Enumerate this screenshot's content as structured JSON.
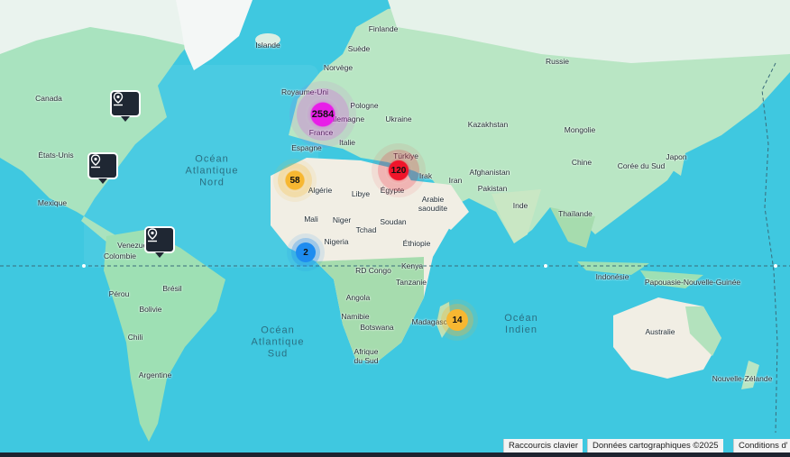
{
  "map": {
    "oceans": [
      {
        "id": "atlantic-north",
        "text": "Océan\nAtlantique\nNord"
      },
      {
        "id": "atlantic-south",
        "text": "Océan\nAtlantique\nSud"
      },
      {
        "id": "indian",
        "text": "Océan\nIndien"
      }
    ],
    "labels": [
      {
        "id": "finlande",
        "text": "Finlande"
      },
      {
        "id": "islande",
        "text": "Islande"
      },
      {
        "id": "suede",
        "text": "Suède"
      },
      {
        "id": "russie",
        "text": "Russie"
      },
      {
        "id": "norvege",
        "text": "Norvège"
      },
      {
        "id": "canada",
        "text": "Canada"
      },
      {
        "id": "royaume-uni",
        "text": "Royaume-Uni"
      },
      {
        "id": "pologne",
        "text": "Pologne"
      },
      {
        "id": "ukraine",
        "text": "Ukraine"
      },
      {
        "id": "kazakhstan",
        "text": "Kazakhstan"
      },
      {
        "id": "allemagne",
        "text": "Allemagne"
      },
      {
        "id": "france",
        "text": "France"
      },
      {
        "id": "mongolie",
        "text": "Mongolie"
      },
      {
        "id": "espagne",
        "text": "Espagne"
      },
      {
        "id": "italie",
        "text": "Italie"
      },
      {
        "id": "turkiye",
        "text": "Türkiye"
      },
      {
        "id": "etats-unis",
        "text": "États-Unis"
      },
      {
        "id": "chine",
        "text": "Chine"
      },
      {
        "id": "japon",
        "text": "Japon"
      },
      {
        "id": "coree-du-sud",
        "text": "Corée du Sud"
      },
      {
        "id": "irak",
        "text": "Irak"
      },
      {
        "id": "afghanistan",
        "text": "Afghanistan"
      },
      {
        "id": "iran",
        "text": "Iran"
      },
      {
        "id": "algerie",
        "text": "Algérie"
      },
      {
        "id": "libye",
        "text": "Libye"
      },
      {
        "id": "egypte",
        "text": "Égypte"
      },
      {
        "id": "pakistan",
        "text": "Pakistan"
      },
      {
        "id": "mexique",
        "text": "Mexique"
      },
      {
        "id": "arabie-saoudite",
        "text": "Arabie saoudite"
      },
      {
        "id": "inde",
        "text": "Inde"
      },
      {
        "id": "thailande",
        "text": "Thaïlande"
      },
      {
        "id": "mali",
        "text": "Mali"
      },
      {
        "id": "niger",
        "text": "Niger"
      },
      {
        "id": "soudan",
        "text": "Soudan"
      },
      {
        "id": "tchad",
        "text": "Tchad"
      },
      {
        "id": "venezuela",
        "text": "Venezuela"
      },
      {
        "id": "nigeria",
        "text": "Nigeria"
      },
      {
        "id": "ethiopie",
        "text": "Éthiopie"
      },
      {
        "id": "colombie",
        "text": "Colombie"
      },
      {
        "id": "rd-congo",
        "text": "RD Congo"
      },
      {
        "id": "kenya",
        "text": "Kenya"
      },
      {
        "id": "indonesie",
        "text": "Indonésie"
      },
      {
        "id": "papouasie",
        "text": "Papouasie-Nouvelle-Guinée"
      },
      {
        "id": "perou",
        "text": "Pérou"
      },
      {
        "id": "bresil",
        "text": "Brésil"
      },
      {
        "id": "tanzanie",
        "text": "Tanzanie"
      },
      {
        "id": "angola",
        "text": "Angola"
      },
      {
        "id": "bolivie",
        "text": "Bolivie"
      },
      {
        "id": "namibie",
        "text": "Namibie"
      },
      {
        "id": "madagascar",
        "text": "Madagascar"
      },
      {
        "id": "botswana",
        "text": "Botswana"
      },
      {
        "id": "australie",
        "text": "Australie"
      },
      {
        "id": "chili",
        "text": "Chili"
      },
      {
        "id": "afrique-du-sud",
        "text": "Afrique\ndu Sud"
      },
      {
        "id": "argentine",
        "text": "Argentine"
      },
      {
        "id": "nouvelle-zelande",
        "text": "Nouvelle-Zélande"
      }
    ],
    "clusters": [
      {
        "id": "europe",
        "count": "2584",
        "color": "#e81ee8"
      },
      {
        "id": "middle-east",
        "count": "120",
        "color": "#f0152b"
      },
      {
        "id": "north-africa",
        "count": "58",
        "color": "#f7b731"
      },
      {
        "id": "west-africa",
        "count": "2",
        "color": "#1e8cf0"
      },
      {
        "id": "madagascar",
        "count": "14",
        "color": "#f7b731"
      }
    ],
    "pins": [
      {
        "id": "canada-east",
        "icon": "location-pin-icon"
      },
      {
        "id": "usa-east",
        "icon": "location-pin-icon"
      },
      {
        "id": "venezuela",
        "icon": "location-pin-icon"
      }
    ]
  },
  "attribution": {
    "shortcuts": "Raccourcis clavier",
    "map_data": "Données cartographiques ©2025",
    "terms": "Conditions d'"
  }
}
